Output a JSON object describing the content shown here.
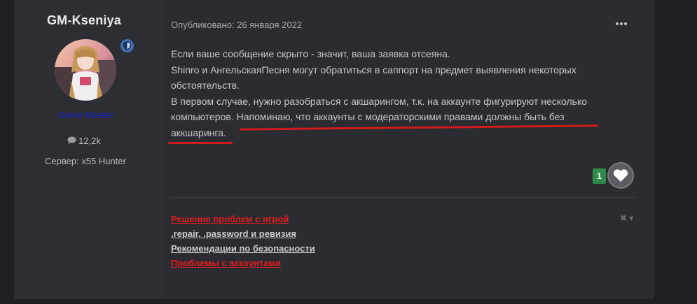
{
  "author": {
    "name": "GM-Kseniya",
    "group": "Game Master",
    "posts": "12,2k",
    "server": "Сервер: x55 Hunter",
    "posts_icon": "comment-icon",
    "badge_icon": "shield-icon"
  },
  "post": {
    "published": "Опубликовано: 26 января 2022",
    "more_icon": "more-horizontal-icon",
    "lines": [
      "Если ваше сообщение скрыто - значит, ваша заявка отсеяна.",
      "Shinro и АнгельскаяПесня могут обратиться в саппорт на предмет выявления некоторых обстоятельств.",
      "В первом случае, нужно разобраться с акшарингом, т.к. на аккаунте фигурируют несколько компьютеров.",
      "Напоминаю, что аккаунты с модераторскими правами должны быть без аккшаринга."
    ],
    "reactions": {
      "count": "1",
      "icon": "heart-icon"
    }
  },
  "signature": {
    "links": [
      {
        "label": "Решение проблем с игрой",
        "color": "#e51b1b"
      },
      {
        "label": ".repair, .password и ревизия",
        "color": "#c8cacd"
      },
      {
        "label": "Рекомендации по безопасности",
        "color": "#c8cacd"
      },
      {
        "label": "Проблемы с аккаунтами",
        "color": "#e51b1b"
      }
    ],
    "close_icon": "close-icon"
  },
  "colors": {
    "background": "#1e2024",
    "panel": "#2a2c31",
    "group": "#1a22d0",
    "highlight_underline": "#d11a1a",
    "reaction_badge": "#2f8a4b"
  }
}
